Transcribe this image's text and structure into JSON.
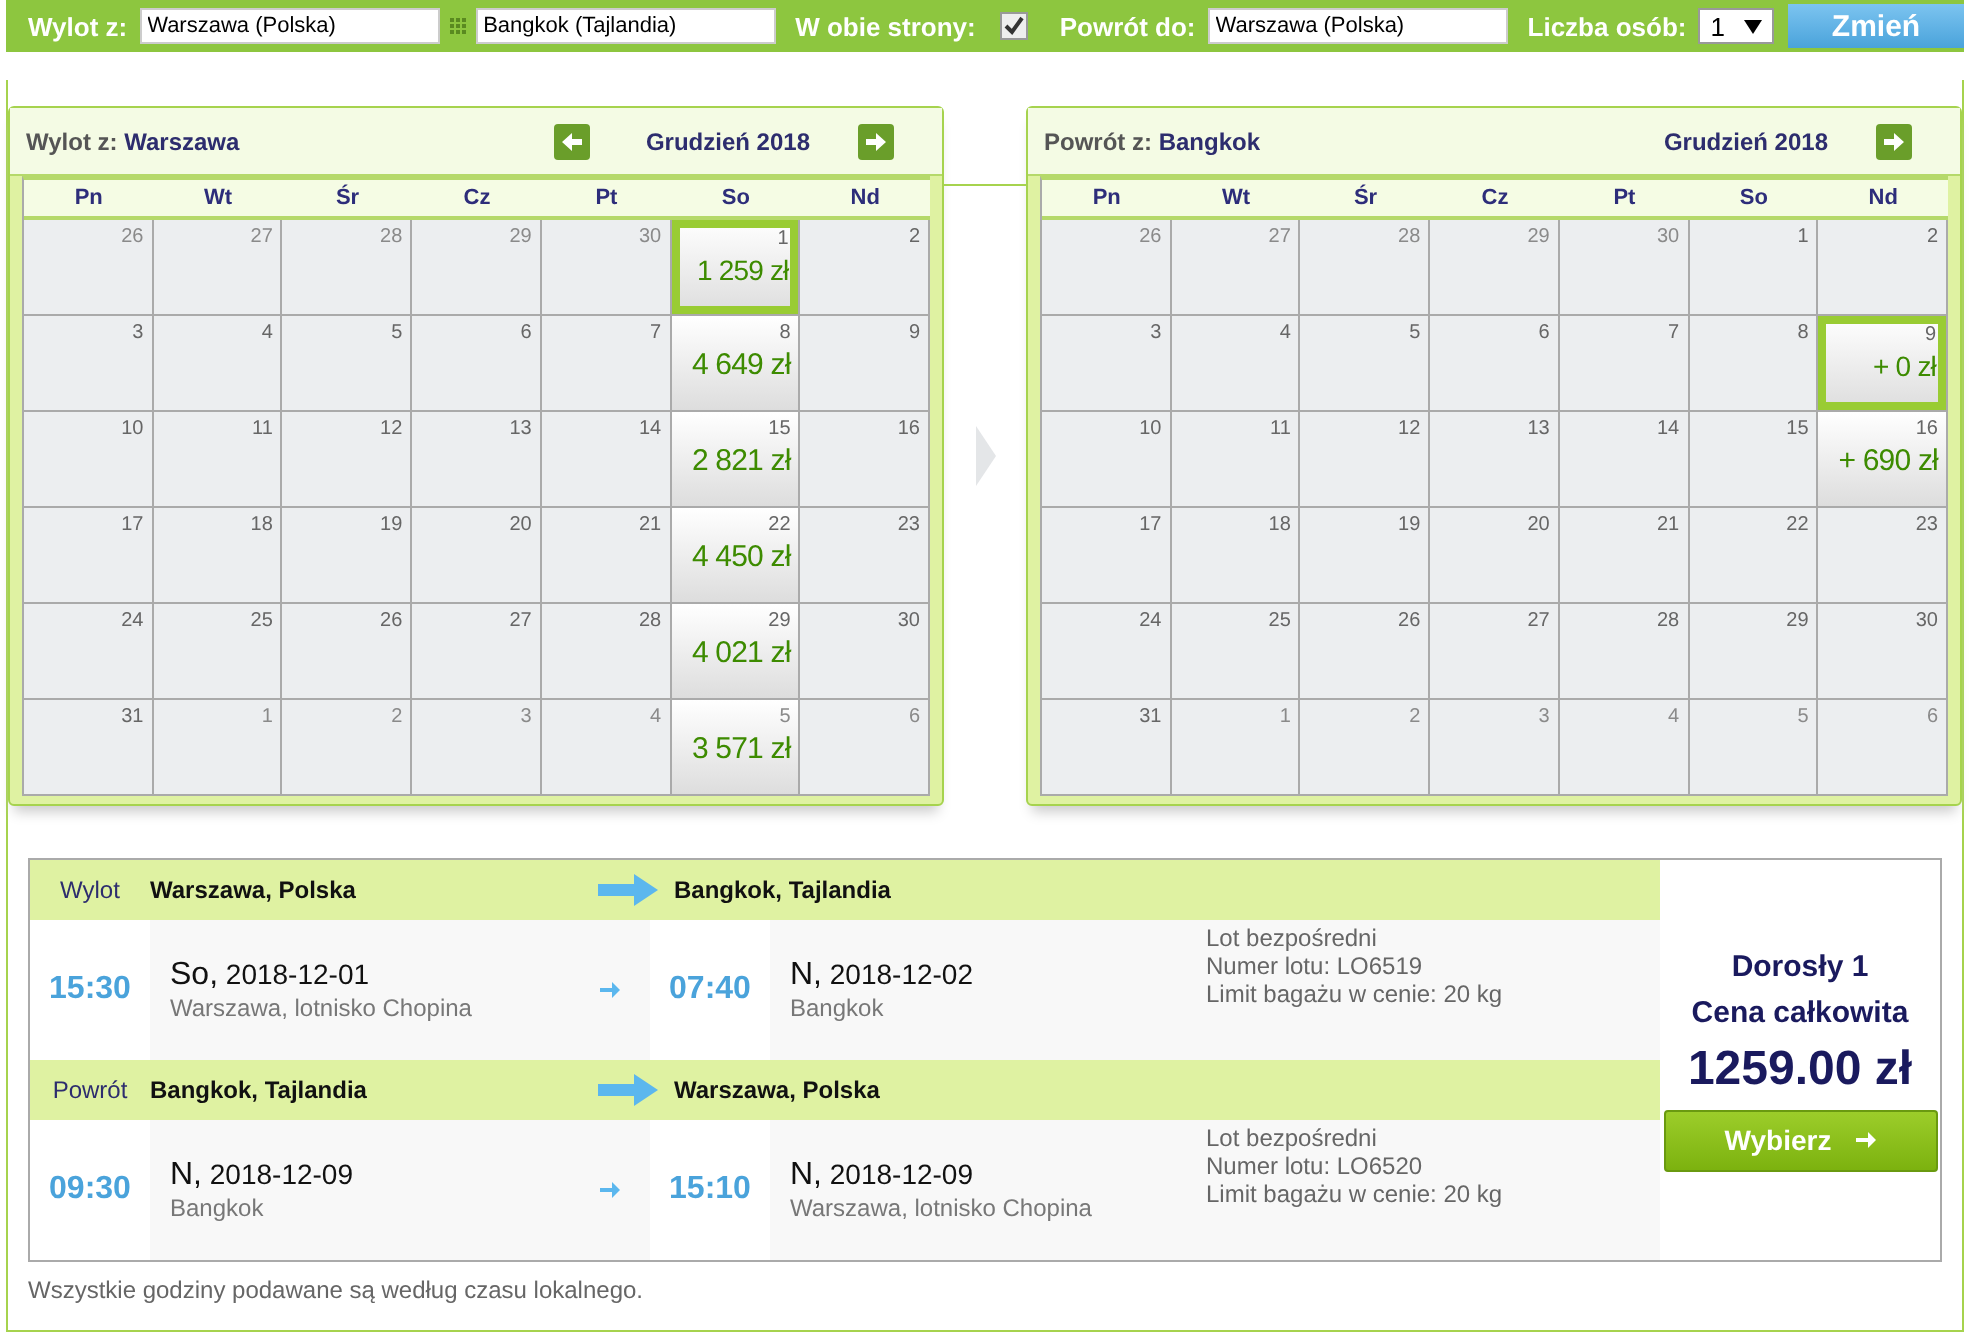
{
  "search_bar": {
    "from_label": "Wylot z:",
    "from_value": "Warszawa (Polska)",
    "to_value": "Bangkok (Tajlandia)",
    "round_trip_label": "W obie strony:",
    "round_trip_checked": true,
    "return_label": "Powrót do:",
    "return_value": "Warszawa (Polska)",
    "passengers_label": "Liczba osób:",
    "passengers_value": "1",
    "submit": "Zmień"
  },
  "calendars": [
    {
      "title_label": "Wylot z:",
      "title_city": "Warszawa",
      "month": "Grudzień 2018",
      "has_prev": true,
      "has_next": true,
      "weekdays": [
        "Pn",
        "Wt",
        "Śr",
        "Cz",
        "Pt",
        "So",
        "Nd"
      ],
      "weeks": [
        [
          {
            "day": "26",
            "muted": true,
            "selected": false
          },
          {
            "day": "27",
            "muted": true,
            "selected": false
          },
          {
            "day": "28",
            "muted": true,
            "selected": false
          },
          {
            "day": "29",
            "muted": true,
            "selected": false
          },
          {
            "day": "30",
            "muted": true,
            "selected": false
          },
          {
            "day": "1",
            "muted": false,
            "selected": true,
            "price": "1 259 zł"
          },
          {
            "day": "2",
            "muted": false,
            "selected": false
          }
        ],
        [
          {
            "day": "3",
            "muted": false,
            "selected": false
          },
          {
            "day": "4",
            "muted": false,
            "selected": false
          },
          {
            "day": "5",
            "muted": false,
            "selected": false
          },
          {
            "day": "6",
            "muted": false,
            "selected": false
          },
          {
            "day": "7",
            "muted": false,
            "selected": false
          },
          {
            "day": "8",
            "muted": false,
            "selected": false,
            "price": "4 649 zł"
          },
          {
            "day": "9",
            "muted": false,
            "selected": false
          }
        ],
        [
          {
            "day": "10",
            "muted": false,
            "selected": false
          },
          {
            "day": "11",
            "muted": false,
            "selected": false
          },
          {
            "day": "12",
            "muted": false,
            "selected": false
          },
          {
            "day": "13",
            "muted": false,
            "selected": false
          },
          {
            "day": "14",
            "muted": false,
            "selected": false
          },
          {
            "day": "15",
            "muted": false,
            "selected": false,
            "price": "2 821 zł"
          },
          {
            "day": "16",
            "muted": false,
            "selected": false
          }
        ],
        [
          {
            "day": "17",
            "muted": false,
            "selected": false
          },
          {
            "day": "18",
            "muted": false,
            "selected": false
          },
          {
            "day": "19",
            "muted": false,
            "selected": false
          },
          {
            "day": "20",
            "muted": false,
            "selected": false
          },
          {
            "day": "21",
            "muted": false,
            "selected": false
          },
          {
            "day": "22",
            "muted": false,
            "selected": false,
            "price": "4 450 zł"
          },
          {
            "day": "23",
            "muted": false,
            "selected": false
          }
        ],
        [
          {
            "day": "24",
            "muted": false,
            "selected": false
          },
          {
            "day": "25",
            "muted": false,
            "selected": false
          },
          {
            "day": "26",
            "muted": false,
            "selected": false
          },
          {
            "day": "27",
            "muted": false,
            "selected": false
          },
          {
            "day": "28",
            "muted": false,
            "selected": false
          },
          {
            "day": "29",
            "muted": false,
            "selected": false,
            "price": "4 021 zł"
          },
          {
            "day": "30",
            "muted": false,
            "selected": false
          }
        ],
        [
          {
            "day": "31",
            "muted": false,
            "selected": false
          },
          {
            "day": "1",
            "muted": true,
            "selected": false
          },
          {
            "day": "2",
            "muted": true,
            "selected": false
          },
          {
            "day": "3",
            "muted": true,
            "selected": false
          },
          {
            "day": "4",
            "muted": true,
            "selected": false
          },
          {
            "day": "5",
            "muted": true,
            "selected": false,
            "price": "3 571 zł"
          },
          {
            "day": "6",
            "muted": true,
            "selected": false
          }
        ]
      ]
    },
    {
      "title_label": "Powrót z:",
      "title_city": "Bangkok",
      "month": "Grudzień 2018",
      "has_prev": false,
      "has_next": true,
      "weekdays": [
        "Pn",
        "Wt",
        "Śr",
        "Cz",
        "Pt",
        "So",
        "Nd"
      ],
      "weeks": [
        [
          {
            "day": "26",
            "muted": true,
            "selected": false
          },
          {
            "day": "27",
            "muted": true,
            "selected": false
          },
          {
            "day": "28",
            "muted": true,
            "selected": false
          },
          {
            "day": "29",
            "muted": true,
            "selected": false
          },
          {
            "day": "30",
            "muted": true,
            "selected": false
          },
          {
            "day": "1",
            "muted": false,
            "selected": false
          },
          {
            "day": "2",
            "muted": false,
            "selected": false
          }
        ],
        [
          {
            "day": "3",
            "muted": false,
            "selected": false
          },
          {
            "day": "4",
            "muted": false,
            "selected": false
          },
          {
            "day": "5",
            "muted": false,
            "selected": false
          },
          {
            "day": "6",
            "muted": false,
            "selected": false
          },
          {
            "day": "7",
            "muted": false,
            "selected": false
          },
          {
            "day": "8",
            "muted": false,
            "selected": false
          },
          {
            "day": "9",
            "muted": false,
            "selected": true,
            "price": "+ 0 zł"
          }
        ],
        [
          {
            "day": "10",
            "muted": false,
            "selected": false
          },
          {
            "day": "11",
            "muted": false,
            "selected": false
          },
          {
            "day": "12",
            "muted": false,
            "selected": false
          },
          {
            "day": "13",
            "muted": false,
            "selected": false
          },
          {
            "day": "14",
            "muted": false,
            "selected": false
          },
          {
            "day": "15",
            "muted": false,
            "selected": false
          },
          {
            "day": "16",
            "muted": false,
            "selected": false,
            "price": "+ 690 zł"
          }
        ],
        [
          {
            "day": "17",
            "muted": false,
            "selected": false
          },
          {
            "day": "18",
            "muted": false,
            "selected": false
          },
          {
            "day": "19",
            "muted": false,
            "selected": false
          },
          {
            "day": "20",
            "muted": false,
            "selected": false
          },
          {
            "day": "21",
            "muted": false,
            "selected": false
          },
          {
            "day": "22",
            "muted": false,
            "selected": false
          },
          {
            "day": "23",
            "muted": false,
            "selected": false
          }
        ],
        [
          {
            "day": "24",
            "muted": false,
            "selected": false
          },
          {
            "day": "25",
            "muted": false,
            "selected": false
          },
          {
            "day": "26",
            "muted": false,
            "selected": false
          },
          {
            "day": "27",
            "muted": false,
            "selected": false
          },
          {
            "day": "28",
            "muted": false,
            "selected": false
          },
          {
            "day": "29",
            "muted": false,
            "selected": false
          },
          {
            "day": "30",
            "muted": false,
            "selected": false
          }
        ],
        [
          {
            "day": "31",
            "muted": false,
            "selected": false
          },
          {
            "day": "1",
            "muted": true,
            "selected": false
          },
          {
            "day": "2",
            "muted": true,
            "selected": false
          },
          {
            "day": "3",
            "muted": true,
            "selected": false
          },
          {
            "day": "4",
            "muted": true,
            "selected": false
          },
          {
            "day": "5",
            "muted": true,
            "selected": false
          },
          {
            "day": "6",
            "muted": true,
            "selected": false
          }
        ]
      ]
    }
  ],
  "flights": [
    {
      "label": "Wylot",
      "from": "Warszawa, Polska",
      "to": "Bangkok, Tajlandia",
      "dep_time": "15:30",
      "dep_day": "So,",
      "dep_date": "2018-12-01",
      "dep_place": "Warszawa, lotnisko Chopina",
      "arr_time": "07:40",
      "arr_day": "N,",
      "arr_date": "2018-12-02",
      "arr_place": "Bangkok",
      "info": [
        "Lot bezpośredni",
        "Numer lotu: LO6519",
        "Limit bagażu w cenie: 20 kg"
      ]
    },
    {
      "label": "Powrót",
      "from": "Bangkok, Tajlandia",
      "to": "Warszawa, Polska",
      "dep_time": "09:30",
      "dep_day": "N,",
      "dep_date": "2018-12-09",
      "dep_place": "Bangkok",
      "arr_time": "15:10",
      "arr_day": "N,",
      "arr_date": "2018-12-09",
      "arr_place": "Warszawa, lotnisko Chopina",
      "info": [
        "Lot bezpośredni",
        "Numer lotu: LO6520",
        "Limit bagażu w cenie: 20 kg"
      ]
    }
  ],
  "price_panel": {
    "passengers": "Dorosły 1",
    "total_label": "Cena całkowita",
    "total": "1259.00 zł",
    "select_button": "Wybierz"
  },
  "footnote": "Wszystkie godziny podawane są według czasu lokalnego."
}
